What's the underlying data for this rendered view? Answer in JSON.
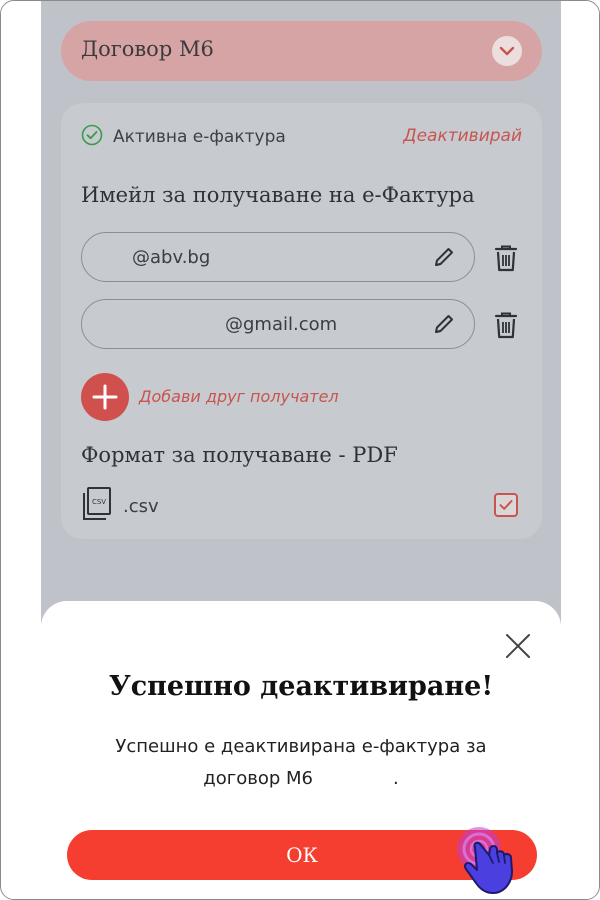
{
  "contract": {
    "label": "Договор М6",
    "icon": "chevron-down-icon"
  },
  "einvoice": {
    "status_label": "Активна е-фактура",
    "deactivate_link": "Деактивирай",
    "email_section_title": "Имейл за получаване на е-Фактура",
    "emails": [
      {
        "value": "@abv.bg"
      },
      {
        "value": "@gmail.com"
      }
    ],
    "add_recipient_label": "Добави друг получател",
    "format_title": "Формат за получаване - PDF",
    "csv_label": ".csv",
    "csv_checked": true
  },
  "dialog": {
    "title": "Успешно деактивиране!",
    "message_line1": "Успешно е деактивирана е-фактура за",
    "message_line2": "договор М6",
    "message_end": ".",
    "ok_label": "ОК"
  },
  "colors": {
    "accent": "#f53e2f",
    "link": "#c9544f",
    "success": "#3a9a4a"
  }
}
